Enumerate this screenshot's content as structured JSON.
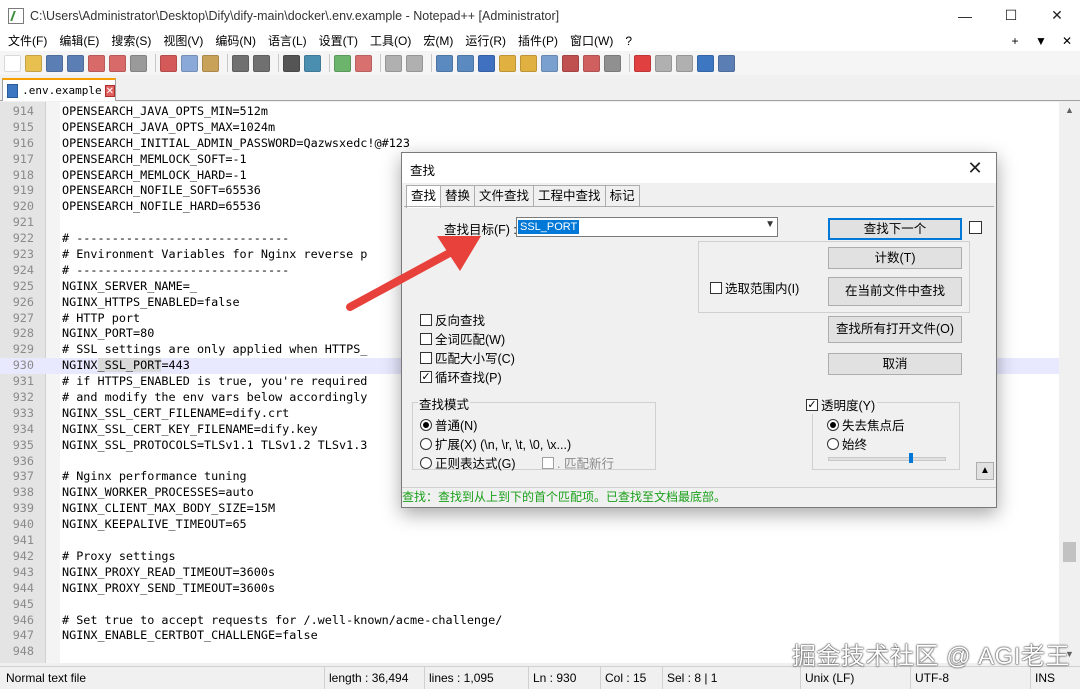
{
  "window": {
    "title": "C:\\Users\\Administrator\\Desktop\\Dify\\dify-main\\docker\\.env.example - Notepad++ [Administrator]",
    "minimize": "—",
    "maximize": "☐",
    "close": "✕"
  },
  "menu": {
    "items": [
      "文件(F)",
      "编辑(E)",
      "搜索(S)",
      "视图(V)",
      "编码(N)",
      "语言(L)",
      "设置(T)",
      "工具(O)",
      "宏(M)",
      "运行(R)",
      "插件(P)",
      "窗口(W)",
      "?"
    ],
    "right": [
      "+",
      "▼",
      "✕"
    ]
  },
  "tabs": [
    {
      "label": ".env.example",
      "close": "✕"
    }
  ],
  "editor": {
    "current_line": 930,
    "lines": [
      {
        "n": "914",
        "t": "OPENSEARCH_JAVA_OPTS_MIN=512m"
      },
      {
        "n": "915",
        "t": "OPENSEARCH_JAVA_OPTS_MAX=1024m"
      },
      {
        "n": "916",
        "t": "OPENSEARCH_INITIAL_ADMIN_PASSWORD=Qazwsxedc!@#123"
      },
      {
        "n": "917",
        "t": "OPENSEARCH_MEMLOCK_SOFT=-1"
      },
      {
        "n": "918",
        "t": "OPENSEARCH_MEMLOCK_HARD=-1"
      },
      {
        "n": "919",
        "t": "OPENSEARCH_NOFILE_SOFT=65536"
      },
      {
        "n": "920",
        "t": "OPENSEARCH_NOFILE_HARD=65536"
      },
      {
        "n": "921",
        "t": ""
      },
      {
        "n": "922",
        "t": "# ------------------------------"
      },
      {
        "n": "923",
        "t": "# Environment Variables for Nginx reverse p"
      },
      {
        "n": "924",
        "t": "# ------------------------------"
      },
      {
        "n": "925",
        "t": "NGINX_SERVER_NAME=_"
      },
      {
        "n": "926",
        "t": "NGINX_HTTPS_ENABLED=false"
      },
      {
        "n": "927",
        "t": "# HTTP port"
      },
      {
        "n": "928",
        "t": "NGINX_PORT=80"
      },
      {
        "n": "929",
        "t": "# SSL settings are only applied when HTTPS_"
      },
      {
        "n": "930",
        "t": "NGINX_SSL_PORT=443"
      },
      {
        "n": "931",
        "t": "# if HTTPS_ENABLED is true, you're required"
      },
      {
        "n": "932",
        "t": "# and modify the env vars below accordingly"
      },
      {
        "n": "933",
        "t": "NGINX_SSL_CERT_FILENAME=dify.crt"
      },
      {
        "n": "934",
        "t": "NGINX_SSL_CERT_KEY_FILENAME=dify.key"
      },
      {
        "n": "935",
        "t": "NGINX_SSL_PROTOCOLS=TLSv1.1 TLSv1.2 TLSv1.3"
      },
      {
        "n": "936",
        "t": ""
      },
      {
        "n": "937",
        "t": "# Nginx performance tuning"
      },
      {
        "n": "938",
        "t": "NGINX_WORKER_PROCESSES=auto"
      },
      {
        "n": "939",
        "t": "NGINX_CLIENT_MAX_BODY_SIZE=15M"
      },
      {
        "n": "940",
        "t": "NGINX_KEEPALIVE_TIMEOUT=65"
      },
      {
        "n": "941",
        "t": ""
      },
      {
        "n": "942",
        "t": "# Proxy settings"
      },
      {
        "n": "943",
        "t": "NGINX_PROXY_READ_TIMEOUT=3600s"
      },
      {
        "n": "944",
        "t": "NGINX_PROXY_SEND_TIMEOUT=3600s"
      },
      {
        "n": "945",
        "t": ""
      },
      {
        "n": "946",
        "t": "# Set true to accept requests for /.well-known/acme-challenge/"
      },
      {
        "n": "947",
        "t": "NGINX_ENABLE_CERTBOT_CHALLENGE=false"
      },
      {
        "n": "948",
        "t": ""
      }
    ],
    "highlight_line_930": {
      "pre": "NGINX",
      "mid": "_SSL_PORT",
      "post": "=443"
    }
  },
  "statusbar": {
    "type": "Normal text file",
    "length": "length : 36,494",
    "lines": "lines : 1,095",
    "ln": "Ln : 930",
    "col": "Col : 15",
    "sel": "Sel : 8 | 1",
    "eol": "Unix (LF)",
    "encoding": "UTF-8",
    "mode": "INS"
  },
  "watermark": "掘金技术社区 @ AGI老王",
  "dialog": {
    "title": "查找",
    "close": "✕",
    "tabs": [
      "查找",
      "替换",
      "文件查找",
      "工程中查找",
      "标记"
    ],
    "find_label": "查找目标(F) :",
    "find_value": "SSL_PORT",
    "buttons": {
      "find_next": "查找下一个",
      "count": "计数(T)",
      "find_in_current": "在当前文件中查找",
      "find_all_open": "查找所有打开文件(O)",
      "cancel": "取消"
    },
    "in_selection": "选取范围内(I)",
    "options": [
      "反向查找",
      "全词匹配(W)",
      "匹配大小写(C)",
      "循环查找(P)"
    ],
    "options_checked": [
      false,
      false,
      false,
      true
    ],
    "search_mode": {
      "title": "查找模式",
      "normal": "普通(N)",
      "extended": "扩展(X) (\\n, \\r, \\t, \\0, \\x...)",
      "regex": "正则表达式(G)",
      "dot_newline": ". 匹配新行"
    },
    "transparency": {
      "title": "透明度(Y)",
      "on_lose_focus": "失去焦点后",
      "always": "始终",
      "level_percent": 70
    },
    "status": "查找：查找到从上到下的首个匹配项。已查找至文档最底部。"
  },
  "colors": {
    "arrow": "#e8403a",
    "selection": "#0078d7",
    "status_green": "#1aa01a",
    "current_line": "#e8e8ff"
  }
}
